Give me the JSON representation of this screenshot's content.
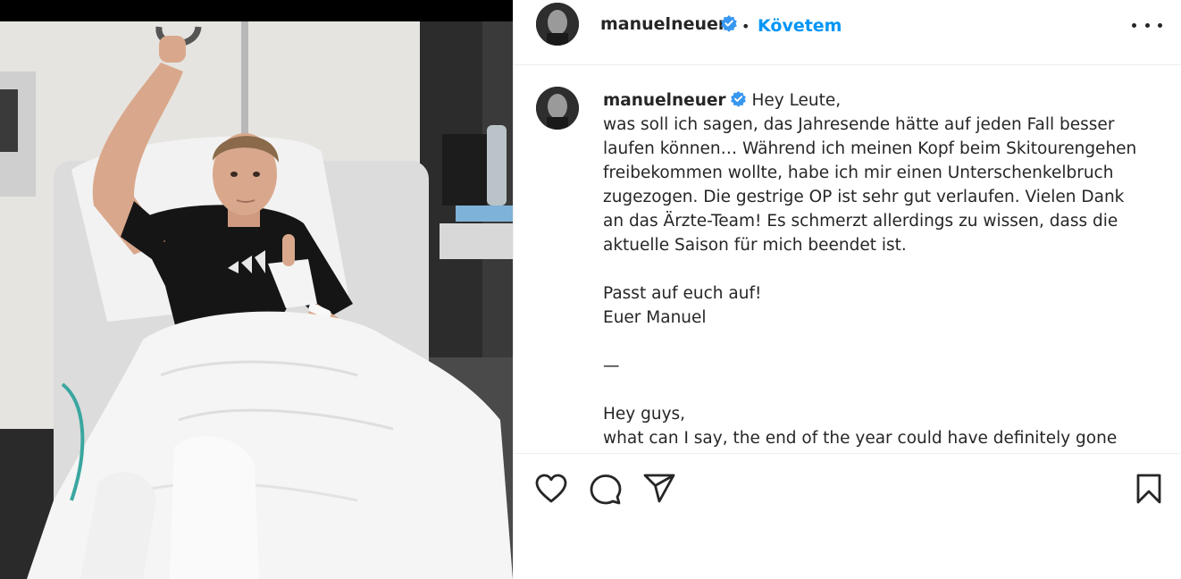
{
  "post": {
    "username": "manuelneuer",
    "follow_label": "Követem",
    "separator": "•",
    "verified_icon": "verified-badge-icon",
    "more_icon": "more-options-icon"
  },
  "caption": {
    "username": "manuelneuer",
    "text": " Hey Leute,\nwas soll ich sagen, das Jahresende hätte auf jeden Fall besser laufen können… Während ich meinen Kopf beim Skitourengehen freibekommen wollte, habe ich mir einen Unterschenkelbruch zugezogen. Die gestrige OP ist sehr gut verlaufen. Vielen Dank an das Ärzte-Team! Es schmerzt allerdings zu wissen, dass die aktuelle Saison für mich beendet ist.\n\nPasst auf euch auf!\nEuer Manuel\n\n—\n\nHey guys,\nwhat can I say, the end of the year could have definitely gone"
  },
  "actions": {
    "like_icon": "heart-icon",
    "comment_icon": "comment-icon",
    "share_icon": "share-icon",
    "save_icon": "bookmark-icon"
  },
  "colors": {
    "accent": "#0095f6",
    "verified": "#3897f0",
    "text": "#262626",
    "border": "#efefef"
  }
}
